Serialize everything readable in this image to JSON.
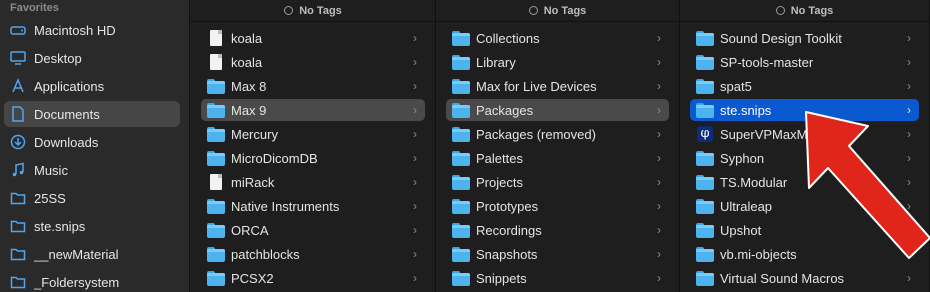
{
  "sidebar": {
    "header": "Favorites",
    "items": [
      {
        "label": "Macintosh HD",
        "icon": "drive-icon"
      },
      {
        "label": "Desktop",
        "icon": "desktop-icon"
      },
      {
        "label": "Applications",
        "icon": "applications-icon"
      },
      {
        "label": "Documents",
        "icon": "document-icon",
        "selected": true
      },
      {
        "label": "Downloads",
        "icon": "download-icon"
      },
      {
        "label": "Music",
        "icon": "music-icon"
      },
      {
        "label": "25SS",
        "icon": "folder-icon"
      },
      {
        "label": "ste.snips",
        "icon": "folder-icon"
      },
      {
        "label": "__newMaterial",
        "icon": "folder-icon"
      },
      {
        "label": "_Foldersystem",
        "icon": "folder-icon"
      }
    ]
  },
  "columns": [
    {
      "tag_label": "No Tags",
      "items": [
        {
          "label": "koala",
          "kind": "file"
        },
        {
          "label": "koala",
          "kind": "file"
        },
        {
          "label": "Max 8",
          "kind": "folder"
        },
        {
          "label": "Max 9",
          "kind": "folder",
          "state": "selected"
        },
        {
          "label": "Mercury",
          "kind": "folder"
        },
        {
          "label": "MicroDicomDB",
          "kind": "folder"
        },
        {
          "label": "miRack",
          "kind": "file"
        },
        {
          "label": "Native Instruments",
          "kind": "folder"
        },
        {
          "label": "ORCA",
          "kind": "folder"
        },
        {
          "label": "patchblocks",
          "kind": "folder"
        },
        {
          "label": "PCSX2",
          "kind": "folder"
        }
      ]
    },
    {
      "tag_label": "No Tags",
      "items": [
        {
          "label": "Collections",
          "kind": "folder"
        },
        {
          "label": "Library",
          "kind": "folder"
        },
        {
          "label": "Max for Live Devices",
          "kind": "folder"
        },
        {
          "label": "Packages",
          "kind": "folder",
          "state": "selected"
        },
        {
          "label": "Packages (removed)",
          "kind": "folder"
        },
        {
          "label": "Palettes",
          "kind": "folder"
        },
        {
          "label": "Projects",
          "kind": "folder"
        },
        {
          "label": "Prototypes",
          "kind": "folder"
        },
        {
          "label": "Recordings",
          "kind": "folder"
        },
        {
          "label": "Snapshots",
          "kind": "folder"
        },
        {
          "label": "Snippets",
          "kind": "folder"
        }
      ]
    },
    {
      "tag_label": "No Tags",
      "items": [
        {
          "label": "Sound Design Toolkit",
          "kind": "folder"
        },
        {
          "label": "SP-tools-master",
          "kind": "folder"
        },
        {
          "label": "spat5",
          "kind": "folder"
        },
        {
          "label": "ste.snips",
          "kind": "folder",
          "state": "active"
        },
        {
          "label": "SuperVPMaxM",
          "kind": "app",
          "glyph": "φ"
        },
        {
          "label": "Syphon",
          "kind": "folder"
        },
        {
          "label": "TS.Modular",
          "kind": "folder"
        },
        {
          "label": "Ultraleap",
          "kind": "folder"
        },
        {
          "label": "Upshot",
          "kind": "folder"
        },
        {
          "label": "vb.mi-objects",
          "kind": "folder"
        },
        {
          "label": "Virtual Sound Macros",
          "kind": "folder"
        }
      ]
    }
  ],
  "chevron_glyph": "›",
  "colors": {
    "selection_blue": "#0a59d1",
    "selection_gray": "#4a4a4a",
    "arrow_red": "#e0261b"
  }
}
